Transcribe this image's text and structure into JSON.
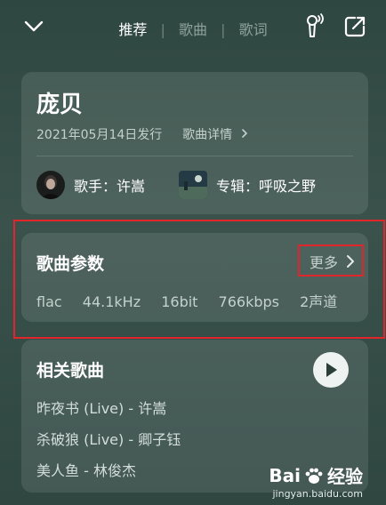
{
  "tabs": [
    "推荐",
    "歌曲",
    "歌词"
  ],
  "song": {
    "title": "庞贝",
    "release_date": "2021年05月14日发行",
    "detail_link": "歌曲详情",
    "singer_label": "歌手：",
    "singer": "许嵩",
    "album_label": "专辑：",
    "album": "呼吸之野"
  },
  "params": {
    "title": "歌曲参数",
    "more": "更多",
    "items": [
      "flac",
      "44.1kHz",
      "16bit",
      "766kbps",
      "2声道"
    ]
  },
  "related": {
    "title": "相关歌曲",
    "songs": [
      "昨夜书 (Live) - 许嵩",
      "杀破狼 (Live) - 卿子钰",
      "美人鱼 - 林俊杰"
    ]
  },
  "watermark": {
    "brand": "Bai",
    "suffix": "经验",
    "url": "jingyan.baidu.com"
  },
  "colors": {
    "highlight": "#e0262a",
    "accent": "#ffffff"
  }
}
